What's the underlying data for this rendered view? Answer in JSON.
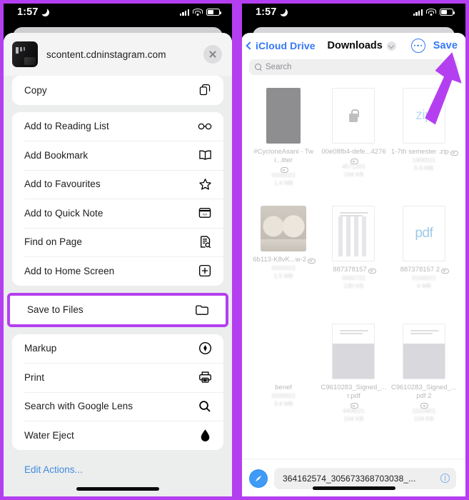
{
  "status_bar": {
    "time": "1:57",
    "moon_icon": "crescent-moon-icon",
    "signal_icon": "cellular-signal-icon",
    "wifi_icon": "wifi-icon",
    "battery_icon": "battery-icon"
  },
  "share_sheet": {
    "host": "scontent.cdninstagram.com",
    "close_icon": "close-icon",
    "favicon": "site-favicon",
    "groups": [
      {
        "items": [
          {
            "label": "Copy",
            "icon": "copy-icon"
          }
        ]
      },
      {
        "items": [
          {
            "label": "Add to Reading List",
            "icon": "glasses-icon"
          },
          {
            "label": "Add Bookmark",
            "icon": "book-icon"
          },
          {
            "label": "Add to Favourites",
            "icon": "star-icon"
          },
          {
            "label": "Add to Quick Note",
            "icon": "quick-note-icon"
          },
          {
            "label": "Find on Page",
            "icon": "find-on-page-icon"
          },
          {
            "label": "Add to Home Screen",
            "icon": "plus-square-icon"
          }
        ]
      }
    ],
    "highlighted": {
      "label": "Save to Files",
      "icon": "folder-icon"
    },
    "group_after": {
      "items": [
        {
          "label": "Markup",
          "icon": "markup-icon"
        },
        {
          "label": "Print",
          "icon": "printer-icon"
        },
        {
          "label": "Search with Google Lens",
          "icon": "search-icon"
        },
        {
          "label": "Water Eject",
          "icon": "water-drop-icon"
        }
      ]
    },
    "edit_actions": "Edit Actions..."
  },
  "files_picker": {
    "back_label": "iCloud Drive",
    "back_icon": "chevron-left-icon",
    "title": "Downloads",
    "title_chevron_icon": "chevron-down-icon",
    "more_icon": "more-circle-icon",
    "save_label": "Save",
    "search": {
      "placeholder": "Search",
      "icon": "search-icon"
    },
    "files": [
      {
        "name": "#CycloneAsani - Twi...itter",
        "date": "0000022",
        "size": "1.4 MB",
        "thumb": "photo-dark",
        "cloud": true
      },
      {
        "name": "00e08fb4-defe...4276",
        "date": "4571201",
        "size": "194 KB",
        "thumb": "locked-doc",
        "cloud": true
      },
      {
        "name": "1-7th semester .zip",
        "date": "1400011",
        "size": "5.6 MB",
        "thumb": "zip",
        "cloud": true
      },
      {
        "name": "6b113-K8vK...w-2",
        "date": "0000022",
        "size": "1.5 MB",
        "thumb": "photo-image",
        "cloud": true
      },
      {
        "name": "887378157",
        "date": "0000722",
        "size": "130 KB",
        "thumb": "doc-lines",
        "cloud": true
      },
      {
        "name": "887378157 2",
        "date": "0100022",
        "size": "4 MB",
        "thumb": "pdf",
        "cloud": true
      },
      {
        "name": "benef",
        "date": "0000022",
        "size": "3.4 MB",
        "thumb": "blank",
        "cloud": false
      },
      {
        "name": "C9610283_Signed_...r.pdf",
        "date": "4406/21",
        "size": "104 KB",
        "thumb": "doc-shade",
        "cloud": true
      },
      {
        "name": "C9610283_Signed_...pdf 2",
        "date": "1020601",
        "size": "104 KB",
        "thumb": "doc-shade",
        "cloud": true
      }
    ],
    "name_bar": {
      "app_icon": "safari-icon",
      "filename": "364162574_305673368703038_...",
      "clear_icon": "clear-field-icon"
    }
  },
  "annotation": {
    "cursor_icon": "pointer-arrow-cursor",
    "highlight_color": "#b43ff0"
  }
}
